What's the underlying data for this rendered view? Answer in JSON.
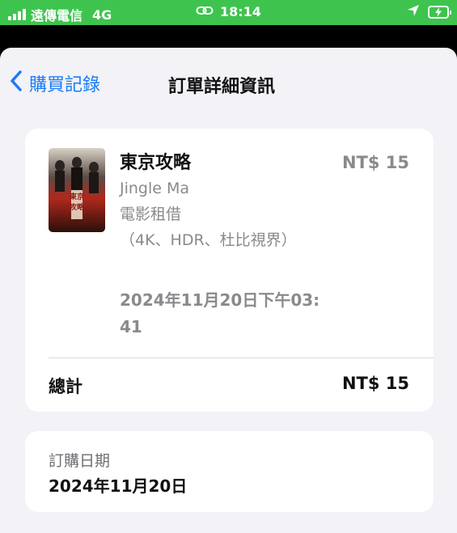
{
  "status_bar": {
    "carrier": "遠傳電信",
    "network": "4G",
    "time": "18:14"
  },
  "nav": {
    "back_label": "購買記錄",
    "title": "訂單詳細資訊"
  },
  "item": {
    "title": "東京攻略",
    "artist": "Jingle Ma",
    "type": "電影租借",
    "format": "（4K、HDR、杜比視界）",
    "price": "NT$ 15",
    "purchase_datetime_line1": "2024年11月20日下午03:",
    "purchase_datetime_line2": "41",
    "poster_title": "東京攻略"
  },
  "total": {
    "label": "總計",
    "value": "NT$ 15"
  },
  "order_date": {
    "label": "訂購日期",
    "value": "2024年11月20日"
  },
  "colors": {
    "status_bar_bg": "#3ec44e",
    "accent": "#1a7cf5",
    "sheet_bg": "#f2f2f7",
    "secondary_text": "#8a8a8e"
  },
  "icons": {
    "back": "chevron-left-icon",
    "link": "link-icon",
    "location": "location-arrow-icon",
    "battery": "battery-charging-icon"
  }
}
